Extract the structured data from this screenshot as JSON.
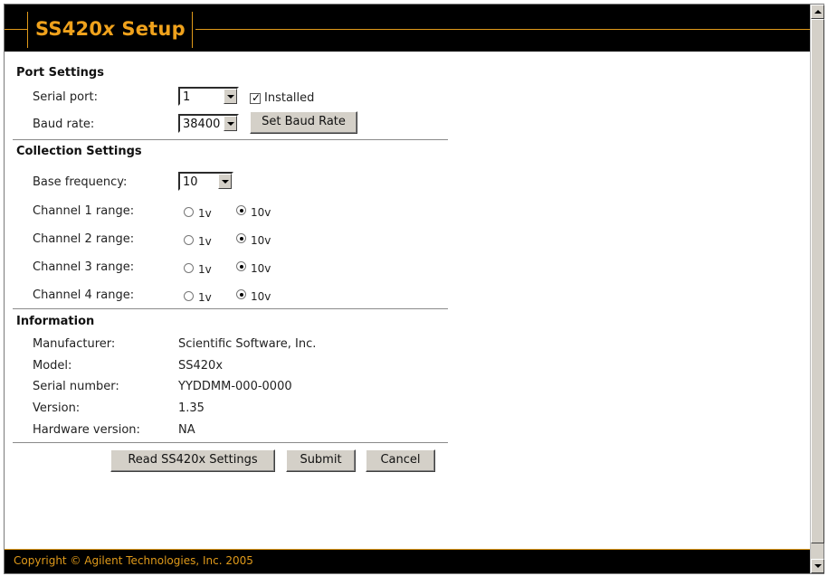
{
  "header": {
    "title_prefix": "SS420",
    "title_italic": "x",
    "title_suffix": " Setup"
  },
  "port_settings": {
    "heading": "Port Settings",
    "serial_port_label": "Serial port:",
    "serial_port_value": "1",
    "installed_label": "Installed",
    "installed_checked": true,
    "baud_rate_label": "Baud rate:",
    "baud_rate_value": "38400",
    "set_baud_button": "Set Baud Rate"
  },
  "collection_settings": {
    "heading": "Collection Settings",
    "base_frequency_label": "Base frequency:",
    "base_frequency_value": "10",
    "option_1v": "1v",
    "option_10v": "10v",
    "channels": [
      {
        "label": "Channel 1 range:",
        "selected": "10v"
      },
      {
        "label": "Channel 2 range:",
        "selected": "10v"
      },
      {
        "label": "Channel 3 range:",
        "selected": "10v"
      },
      {
        "label": "Channel 4 range:",
        "selected": "10v"
      }
    ]
  },
  "information": {
    "heading": "Information",
    "manufacturer_label": "Manufacturer:",
    "manufacturer_value": "Scientific Software, Inc.",
    "model_label": "Model:",
    "model_value": "SS420x",
    "serial_label": "Serial number:",
    "serial_value": "YYDDMM-000-0000",
    "version_label": "Version:",
    "version_value": "1.35",
    "hw_version_label": "Hardware version:",
    "hw_version_value": "NA"
  },
  "actions": {
    "read_label": "Read SS420x Settings",
    "submit_label": "Submit",
    "cancel_label": "Cancel"
  },
  "footer": {
    "copyright": "Copyright © Agilent Technologies, Inc. 2005"
  },
  "colors": {
    "accent": "#e09a1a",
    "header_bg": "#000000",
    "button_face": "#d4d0c8"
  },
  "icons": {
    "dropdown": "chevron-down-icon",
    "scroll_up": "scroll-up-arrow-icon",
    "scroll_down": "scroll-down-arrow-icon"
  }
}
